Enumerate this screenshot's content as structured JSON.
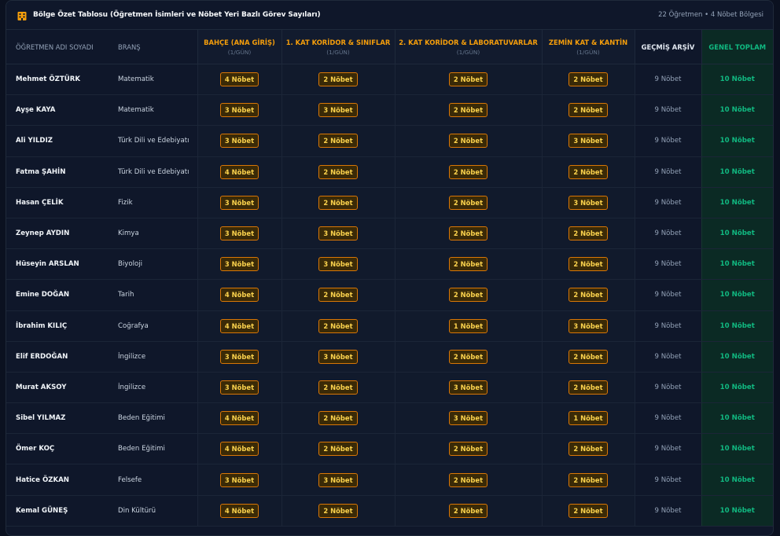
{
  "header": {
    "title": "Bölge Özet Tablosu (Öğretmen İsimleri ve Nöbet Yeri Bazlı Görev Sayıları)",
    "stats": "22 Öğretmen • 4 Nöbet Bölgesi",
    "icon": "building-icon"
  },
  "columns": {
    "teacher": "ÖĞRETMEN ADI SOYADI",
    "branch": "BRANŞ",
    "zones": [
      {
        "name": "BAHÇE (ANA GİRİŞ)",
        "sub": "(1/GÜN)"
      },
      {
        "name": "1. KAT KORİDOR & SINIFLAR",
        "sub": "(1/GÜN)"
      },
      {
        "name": "2. KAT KORİDOR & LABORATUVARLAR",
        "sub": "(1/GÜN)"
      },
      {
        "name": "ZEMİN KAT & KANTİN",
        "sub": "(1/GÜN)"
      }
    ],
    "archive": "GEÇMİŞ ARŞİV",
    "total": "GENEL TOPLAM"
  },
  "colors": {
    "accent": "#f59e0b",
    "total": "#10b981",
    "background": "#0b1120"
  },
  "rows": [
    {
      "name": "Mehmet ÖZTÜRK",
      "branch": "Matematik",
      "zones": [
        "4 Nöbet",
        "2 Nöbet",
        "2 Nöbet",
        "2 Nöbet"
      ],
      "archive": "9 Nöbet",
      "total": "10 Nöbet"
    },
    {
      "name": "Ayşe KAYA",
      "branch": "Matematik",
      "zones": [
        "3 Nöbet",
        "3 Nöbet",
        "2 Nöbet",
        "2 Nöbet"
      ],
      "archive": "9 Nöbet",
      "total": "10 Nöbet"
    },
    {
      "name": "Ali YILDIZ",
      "branch": "Türk Dili ve Edebiyatı",
      "zones": [
        "3 Nöbet",
        "2 Nöbet",
        "2 Nöbet",
        "3 Nöbet"
      ],
      "archive": "9 Nöbet",
      "total": "10 Nöbet"
    },
    {
      "name": "Fatma ŞAHİN",
      "branch": "Türk Dili ve Edebiyatı",
      "zones": [
        "4 Nöbet",
        "2 Nöbet",
        "2 Nöbet",
        "2 Nöbet"
      ],
      "archive": "9 Nöbet",
      "total": "10 Nöbet"
    },
    {
      "name": "Hasan ÇELİK",
      "branch": "Fizik",
      "zones": [
        "3 Nöbet",
        "2 Nöbet",
        "2 Nöbet",
        "3 Nöbet"
      ],
      "archive": "9 Nöbet",
      "total": "10 Nöbet"
    },
    {
      "name": "Zeynep AYDIN",
      "branch": "Kimya",
      "zones": [
        "3 Nöbet",
        "3 Nöbet",
        "2 Nöbet",
        "2 Nöbet"
      ],
      "archive": "9 Nöbet",
      "total": "10 Nöbet"
    },
    {
      "name": "Hüseyin ARSLAN",
      "branch": "Biyoloji",
      "zones": [
        "3 Nöbet",
        "3 Nöbet",
        "2 Nöbet",
        "2 Nöbet"
      ],
      "archive": "9 Nöbet",
      "total": "10 Nöbet"
    },
    {
      "name": "Emine DOĞAN",
      "branch": "Tarih",
      "zones": [
        "4 Nöbet",
        "2 Nöbet",
        "2 Nöbet",
        "2 Nöbet"
      ],
      "archive": "9 Nöbet",
      "total": "10 Nöbet"
    },
    {
      "name": "İbrahim KILIÇ",
      "branch": "Coğrafya",
      "zones": [
        "4 Nöbet",
        "2 Nöbet",
        "1 Nöbet",
        "3 Nöbet"
      ],
      "archive": "9 Nöbet",
      "total": "10 Nöbet"
    },
    {
      "name": "Elif ERDOĞAN",
      "branch": "İngilizce",
      "zones": [
        "3 Nöbet",
        "3 Nöbet",
        "2 Nöbet",
        "2 Nöbet"
      ],
      "archive": "9 Nöbet",
      "total": "10 Nöbet"
    },
    {
      "name": "Murat AKSOY",
      "branch": "İngilizce",
      "zones": [
        "3 Nöbet",
        "2 Nöbet",
        "3 Nöbet",
        "2 Nöbet"
      ],
      "archive": "9 Nöbet",
      "total": "10 Nöbet"
    },
    {
      "name": "Sibel YILMAZ",
      "branch": "Beden Eğitimi",
      "zones": [
        "4 Nöbet",
        "2 Nöbet",
        "3 Nöbet",
        "1 Nöbet"
      ],
      "archive": "9 Nöbet",
      "total": "10 Nöbet"
    },
    {
      "name": "Ömer KOÇ",
      "branch": "Beden Eğitimi",
      "zones": [
        "4 Nöbet",
        "2 Nöbet",
        "2 Nöbet",
        "2 Nöbet"
      ],
      "archive": "9 Nöbet",
      "total": "10 Nöbet"
    },
    {
      "name": "Hatice ÖZKAN",
      "branch": "Felsefe",
      "zones": [
        "3 Nöbet",
        "3 Nöbet",
        "2 Nöbet",
        "2 Nöbet"
      ],
      "archive": "9 Nöbet",
      "total": "10 Nöbet"
    },
    {
      "name": "Kemal GÜNEŞ",
      "branch": "Din Kültürü",
      "zones": [
        "4 Nöbet",
        "2 Nöbet",
        "2 Nöbet",
        "2 Nöbet"
      ],
      "archive": "9 Nöbet",
      "total": "10 Nöbet"
    }
  ]
}
